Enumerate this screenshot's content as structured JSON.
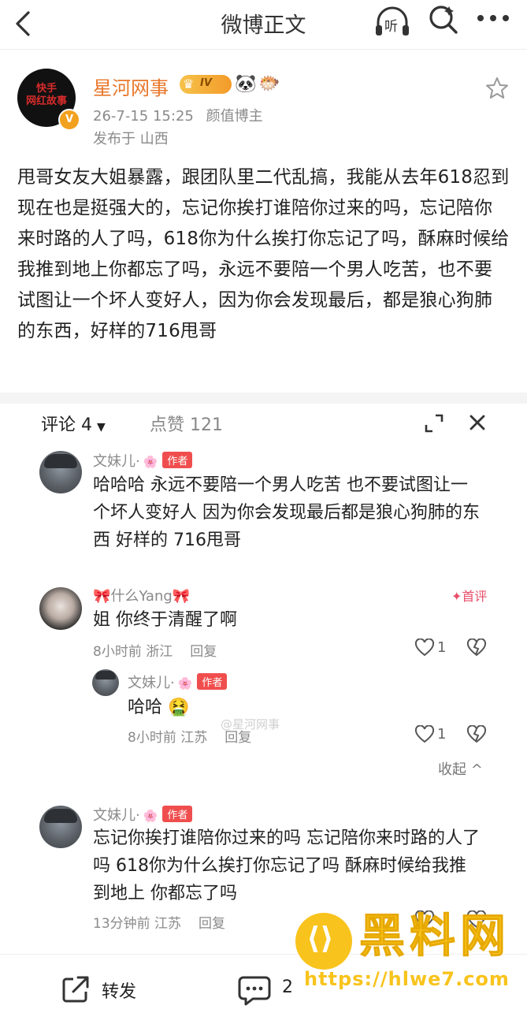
{
  "header": {
    "title": "微博正文",
    "back_icon": "chevron-left-icon",
    "listen_icon": "headphones-icon",
    "listen_label": "听",
    "search_icon": "search-icon",
    "more_icon": "more-icon"
  },
  "post": {
    "author": "星河网事",
    "level": "IV",
    "avatar_text": "快手网红故事",
    "verified_badge": "V",
    "timestamp": "26-7-15 15:25",
    "tag": "颜值博主",
    "location": "发布于 山西",
    "body": "甩哥女友大姐暴露，跟团队里二代乱搞，我能从去年618忍到现在也是挺强大的，忘记你挨打谁陪你过来的吗，忘记陪你来时路的人了吗，618你为什么挨打你忘记了吗，酥麻时候给我推到地上你都忘了吗，永远不要陪一个男人吃苦，也不要试图让一个坏人变好人，因为你会发现最后，都是狼心狗肺的东西，好样的716甩哥"
  },
  "panel": {
    "comment_tab": "评论 4",
    "like_tab": "点赞 121",
    "expand_icon": "expand-icon",
    "close_icon": "close-icon"
  },
  "comments": [
    {
      "name": "文妹儿·",
      "author_tag": "作者",
      "text": "哈哈哈 永远不要陪一个男人吃苦 也不要试图让一个坏人变好人 因为你会发现最后都是狼心狗肺的东西 好样的 716甩哥"
    },
    {
      "name": "🎀什么Yang🎀",
      "badge": "首评",
      "text": "姐 你终于清醒了啊",
      "time": "8小时前 浙江",
      "reply": "回复",
      "likes": "1",
      "replies": [
        {
          "name": "文妹儿·",
          "author_tag": "作者",
          "text": "哈哈 🤮",
          "time": "8小时前 江苏",
          "reply": "回复",
          "likes": "1"
        }
      ],
      "collapse": "收起 ^"
    },
    {
      "name": "文妹儿·",
      "author_tag": "作者",
      "text": "忘记你挨打谁陪你过来的吗 忘记陪你来时路的人了吗 618你为什么挨打你忘记了吗 酥麻时候给我推到地上 你都忘了吗",
      "time": "13分钟前 江苏",
      "reply": "回复"
    }
  ],
  "watermark_mid": "@星河网事",
  "bottom": {
    "repost_label": "转发",
    "comment_count": "2"
  },
  "site_watermark": {
    "title": "黑料网",
    "url": "https://hlwe7.com"
  }
}
